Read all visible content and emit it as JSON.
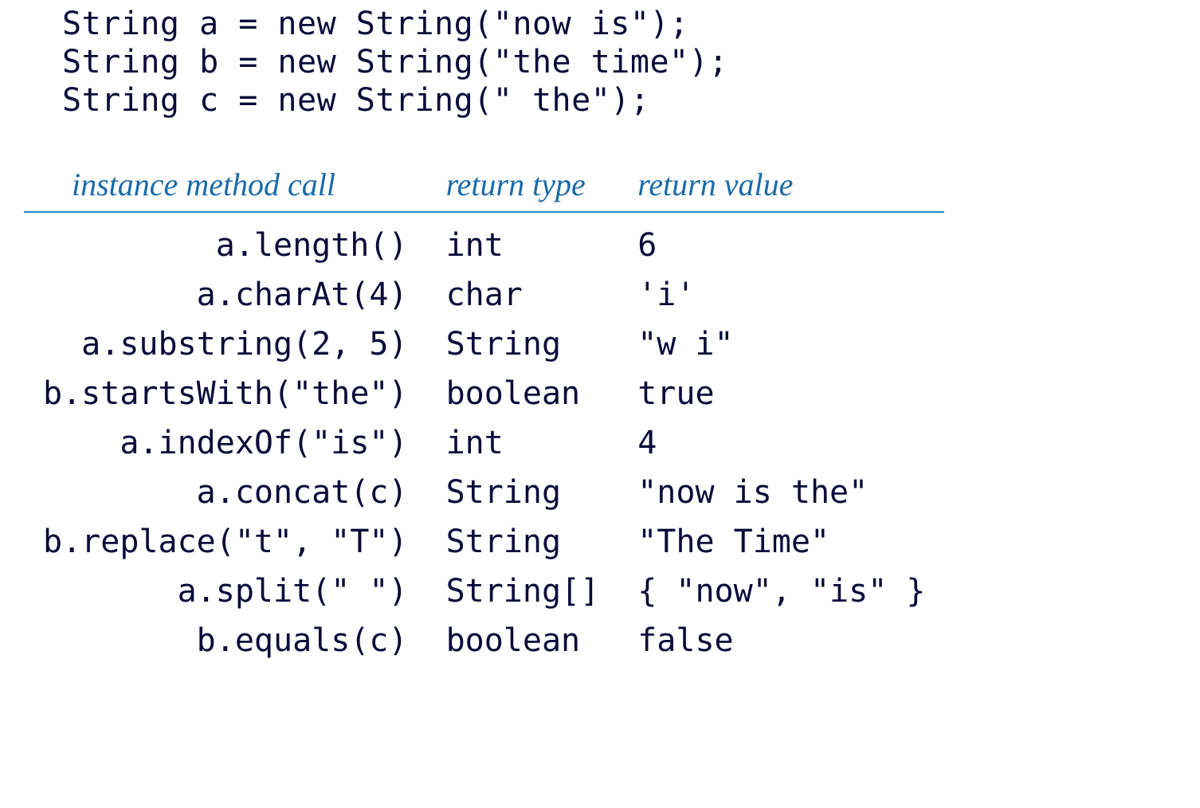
{
  "code": {
    "line1": "String a = new String(\"now is\");",
    "line2": "String b = new String(\"the time\");",
    "line3": "String c = new String(\" the\");"
  },
  "table": {
    "headers": {
      "call": "instance method call",
      "rtype": "return type",
      "rvalue": "return value"
    },
    "rows": [
      {
        "call": "a.length()",
        "rtype": "int",
        "rvalue": "6"
      },
      {
        "call": "a.charAt(4)",
        "rtype": "char",
        "rvalue": "'i'"
      },
      {
        "call": "a.substring(2, 5)",
        "rtype": "String",
        "rvalue": "\"w i\""
      },
      {
        "call": "b.startsWith(\"the\")",
        "rtype": "boolean",
        "rvalue": "true"
      },
      {
        "call": "a.indexOf(\"is\")",
        "rtype": "int",
        "rvalue": "4"
      },
      {
        "call": "a.concat(c)",
        "rtype": "String",
        "rvalue": "\"now is the\""
      },
      {
        "call": "b.replace(\"t\", \"T\")",
        "rtype": "String",
        "rvalue": "\"The Time\""
      },
      {
        "call": "a.split(\" \")",
        "rtype": "String[]",
        "rvalue": "{ \"now\", \"is\" }"
      },
      {
        "call": "b.equals(c)",
        "rtype": "boolean",
        "rvalue": "false"
      }
    ]
  }
}
